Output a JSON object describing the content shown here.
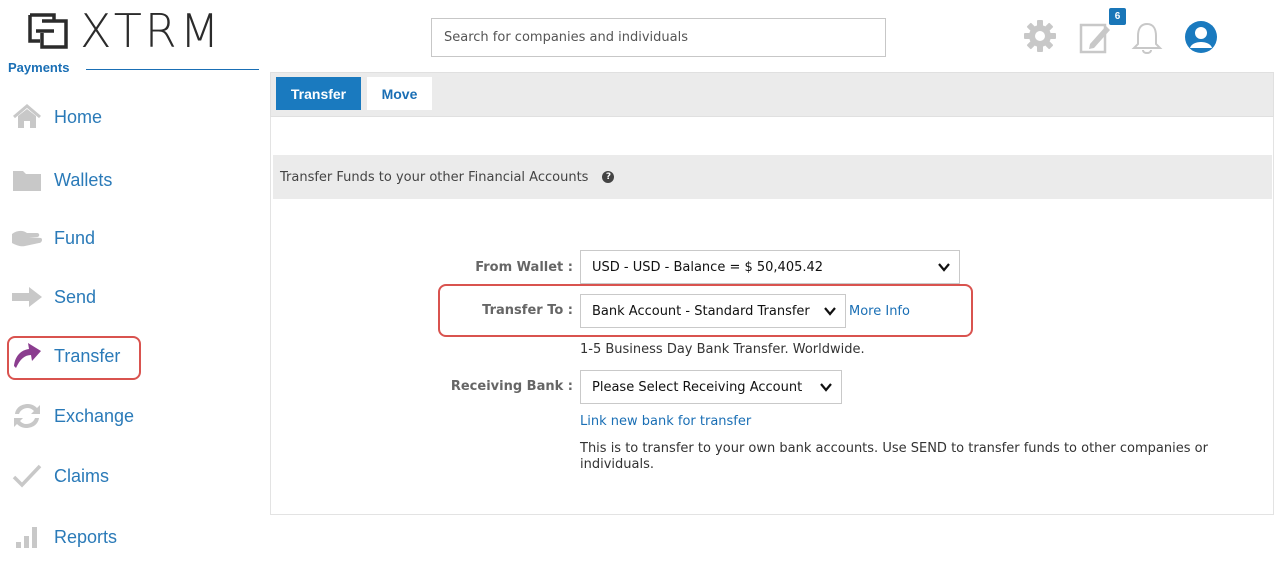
{
  "brand": {
    "name": "XTRM"
  },
  "search": {
    "placeholder": "Search for companies and individuals"
  },
  "header": {
    "notification_count": "6"
  },
  "sidebar": {
    "section_title": "Payments",
    "items": [
      {
        "label": "Home",
        "icon": "home-icon"
      },
      {
        "label": "Wallets",
        "icon": "folder-icon"
      },
      {
        "label": "Fund",
        "icon": "fund-hand-icon"
      },
      {
        "label": "Send",
        "icon": "send-arrow-icon"
      },
      {
        "label": "Transfer",
        "icon": "transfer-icon",
        "active": true
      },
      {
        "label": "Exchange",
        "icon": "exchange-icon"
      },
      {
        "label": "Claims",
        "icon": "checkmark-icon"
      },
      {
        "label": "Reports",
        "icon": "bar-chart-icon"
      }
    ]
  },
  "tabs": [
    {
      "label": "Transfer",
      "active": true
    },
    {
      "label": "Move",
      "active": false
    }
  ],
  "section": {
    "title": "Transfer Funds to your other Financial Accounts"
  },
  "form": {
    "from_wallet_label": "From Wallet :",
    "from_wallet_value": "USD - USD - Balance = $ 50,405.42",
    "transfer_to_label": "Transfer To :",
    "transfer_to_value": "Bank Account - Standard Transfer",
    "more_info": "More Info",
    "transfer_note": "1-5 Business Day Bank Transfer. Worldwide.",
    "receiving_bank_label": "Receiving Bank :",
    "receiving_bank_value": "Please Select Receiving Account",
    "link_new_bank": "Link new bank for transfer",
    "info_text": "This is to transfer to your own bank accounts. Use SEND to transfer funds to other companies or individuals."
  },
  "colors": {
    "accent": "#1a7abf",
    "link": "#1a6fb5",
    "highlight": "#d9534f",
    "transfer_icon": "#8b3d8f"
  }
}
